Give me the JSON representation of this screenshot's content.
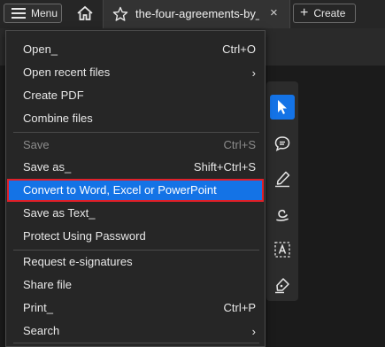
{
  "topbar": {
    "menu_label": "Menu",
    "tab_title": "the-four-agreements-by_",
    "tab_close": "×",
    "create_label": "Create",
    "create_plus": "+"
  },
  "menu": {
    "open": {
      "label": "Open_",
      "shortcut": "Ctrl+O"
    },
    "open_recent": {
      "label": "Open recent files",
      "chevron": "›"
    },
    "create_pdf": {
      "label": "Create PDF"
    },
    "combine": {
      "label": "Combine files"
    },
    "save": {
      "label": "Save",
      "shortcut": "Ctrl+S"
    },
    "save_as": {
      "label": "Save as_",
      "shortcut": "Shift+Ctrl+S"
    },
    "convert": {
      "label": "Convert to Word, Excel or PowerPoint"
    },
    "save_text": {
      "label": "Save as Text_"
    },
    "protect": {
      "label": "Protect Using Password"
    },
    "request_sig": {
      "label": "Request e-signatures"
    },
    "share": {
      "label": "Share file"
    },
    "print": {
      "label": "Print_",
      "shortcut": "Ctrl+P"
    },
    "search": {
      "label": "Search",
      "chevron": "›"
    }
  },
  "colors": {
    "accent": "#1473e6",
    "highlight_border": "#e0202a"
  }
}
